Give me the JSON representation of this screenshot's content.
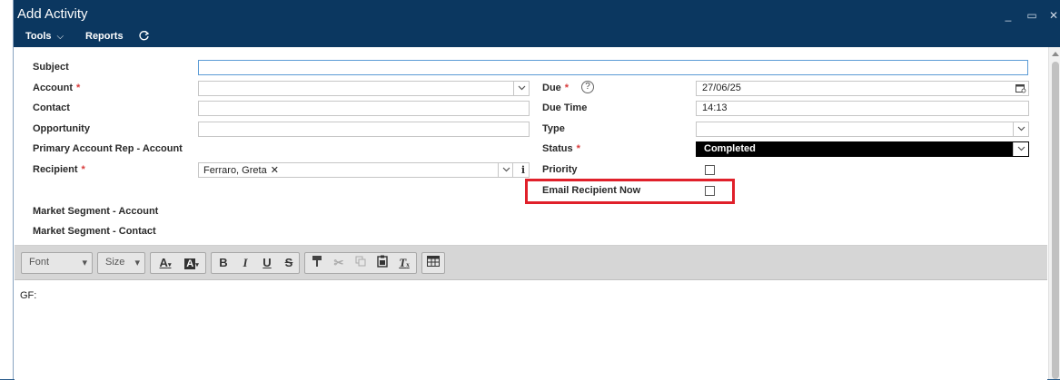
{
  "window": {
    "title": "Add Activity",
    "minimize_glyph": "_",
    "maximize_glyph": "▭",
    "close_glyph": "✕"
  },
  "menu": {
    "tools_label": "Tools",
    "reports_label": "Reports",
    "refresh_icon": "refresh-icon"
  },
  "form": {
    "subject": {
      "label": "Subject",
      "value": ""
    },
    "account": {
      "label": "Account",
      "required": "*",
      "value": ""
    },
    "contact": {
      "label": "Contact",
      "value": ""
    },
    "opportunity": {
      "label": "Opportunity",
      "value": ""
    },
    "primary_rep": {
      "label": "Primary Account Rep - Account"
    },
    "recipient": {
      "label": "Recipient",
      "required": "*",
      "tag": "Ferraro, Greta",
      "tag_remove": "✕",
      "info": "i"
    },
    "market_segment_account": {
      "label": "Market Segment - Account"
    },
    "market_segment_contact": {
      "label": "Market Segment - Contact"
    },
    "due": {
      "label": "Due",
      "required": "*",
      "help": "?",
      "value": "27/06/25"
    },
    "due_time": {
      "label": "Due Time",
      "value": "14:13"
    },
    "type": {
      "label": "Type",
      "value": ""
    },
    "status": {
      "label": "Status",
      "required": "*",
      "value": "Completed"
    },
    "priority": {
      "label": "Priority",
      "checked": false
    },
    "email_recipient_now": {
      "label": "Email Recipient Now",
      "checked": false
    }
  },
  "editor": {
    "font_placeholder": "Font",
    "size_placeholder": "Size",
    "font_color_glyph": "A",
    "bg_color_glyph": "A",
    "bold_glyph": "B",
    "italic_glyph": "I",
    "underline_glyph": "U",
    "strike_glyph": "S",
    "remove_format_glyph": "T",
    "content": "GF:"
  },
  "colors": {
    "titlebar": "#0b3760",
    "required": "#d83a3a",
    "highlight": "#e0202a",
    "status_bg": "#000000"
  }
}
